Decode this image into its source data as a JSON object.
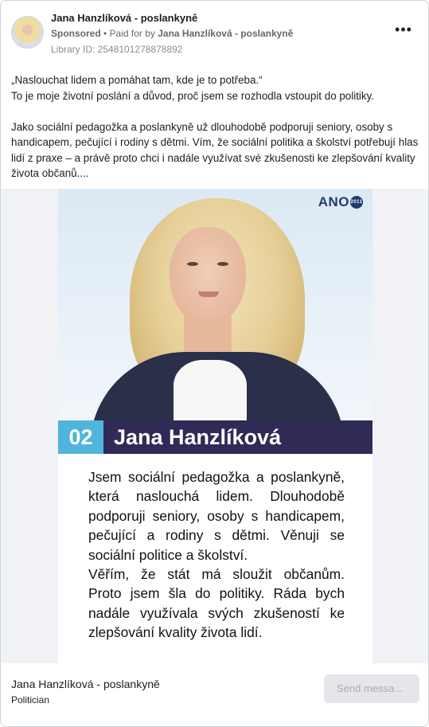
{
  "header": {
    "page_name": "Jana Hanzlíková - poslankyně",
    "sponsored": "Sponsored",
    "separator": " • ",
    "paid_for_by": "Paid for by ",
    "funder": "Jana Hanzlíková - poslankyně",
    "library_id": "Library ID: 2548101278878892",
    "more_icon": "more-horizontal-icon",
    "more_glyph": "•••"
  },
  "ad_text": {
    "line1": "„Naslouchat lidem a pomáhat tam, kde je to potřeba.“",
    "line2": "To je moje životní poslání a důvod, proč jsem se rozhodla vstoupit do politiky.",
    "paragraph2": "Jako sociální pedagožka a poslankyně už dlouhodobě podporuji seniory, osoby s handicapem, pečující i rodiny s dětmi. Vím, že sociální politika a školství potřebují hlas lidí z praxe – a právě proto chci i nadále využívat své zkušenosti ke zlepšování kvality života občanů...."
  },
  "poster": {
    "logo": "ANO",
    "logo_badge": "2011",
    "number": "02",
    "candidate_name": "Jana Hanzlíková",
    "accent_color": "#4fb5dc",
    "bar_color": "#2f2b56",
    "text_lines": [
      "Jsem sociální pedagožka a poslankyně,",
      "která naslouchá lidem. Dlouhodobě",
      "podporuji seniory, osoby s handicapem,",
      "pečující a rodiny s dětmi. Věnuji se",
      "sociální politice a školství.",
      "Věřím, že stát má sloužit občanům.",
      "Proto jsem šla do politiky. Ráda bych",
      "nadále využívala svých zkušeností ke",
      "zlepšování kvality života lidí."
    ]
  },
  "footer": {
    "name": "Jana Hanzlíková - poslankyně",
    "category": "Politician",
    "send_button": "Send messa..."
  }
}
